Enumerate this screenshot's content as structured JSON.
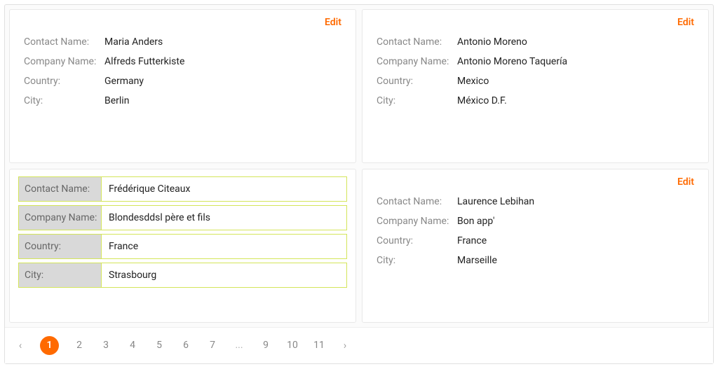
{
  "labels": {
    "contact": "Contact Name:",
    "company": "Company Name:",
    "country": "Country:",
    "city": "City:",
    "edit": "Edit"
  },
  "cards": [
    {
      "editing": false,
      "contact": "Maria Anders",
      "company": "Alfreds Futterkiste",
      "country": "Germany",
      "city": "Berlin"
    },
    {
      "editing": false,
      "contact": "Antonio Moreno",
      "company": "Antonio Moreno Taquería",
      "country": "Mexico",
      "city": "México D.F."
    },
    {
      "editing": true,
      "contact": "Frédérique Citeaux",
      "company": "Blondesddsl père et fils",
      "country": "France",
      "city": "Strasbourg"
    },
    {
      "editing": false,
      "contact": "Laurence Lebihan",
      "company": "Bon app'",
      "country": "France",
      "city": "Marseille"
    }
  ],
  "pager": {
    "pages": [
      "1",
      "2",
      "3",
      "4",
      "5",
      "6",
      "7",
      "...",
      "9",
      "10",
      "11"
    ],
    "current": "1"
  }
}
